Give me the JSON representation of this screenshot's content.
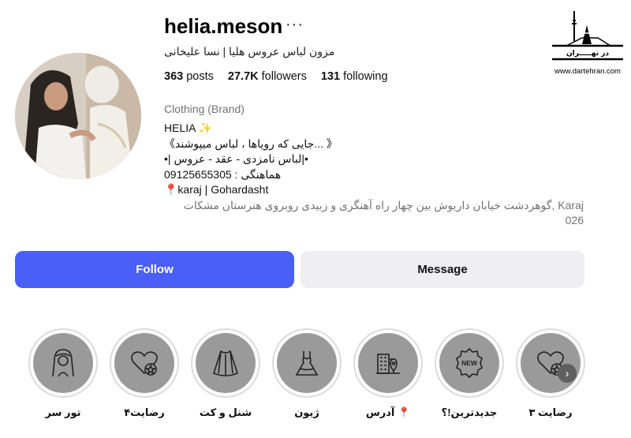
{
  "profile": {
    "username": "helia.meson",
    "more_glyph": "···",
    "full_name": "مزون لباس عروس هلیا | نسا علیخانی",
    "stats": {
      "posts_count": "363",
      "posts_label": "posts",
      "followers_count": "27.7K",
      "followers_label": "followers",
      "following_count": "131",
      "following_label": "following"
    },
    "category": "Clothing (Brand)",
    "bio": "HELIA ✨\n《جایی که رویاها ، لباس میپوشند... 》\n•| لباس نامزدی - عقد - عروس|•\nهماهنگی : 09125655305\n📍karaj | Gohardasht",
    "address": "گوهردشت خیابان داریوش بین چهار راه آهنگری و زبیدی روبروی هنرستان مشکات, Karaj\n026"
  },
  "actions": {
    "follow_label": "Follow",
    "message_label": "Message"
  },
  "highlights": [
    {
      "label": "تور سر",
      "icon": "bride-veil-icon"
    },
    {
      "label": "رضایت۴",
      "icon": "heart-star-icon"
    },
    {
      "label": "شنل و کت",
      "icon": "cape-icon"
    },
    {
      "label": "ژیون",
      "icon": "wedding-dress-icon"
    },
    {
      "label": "آدرس 📍",
      "icon": "building-pin-icon"
    },
    {
      "label": "جدیدترین!؟",
      "icon": "new-badge-icon"
    },
    {
      "label": "رضایت ۳",
      "icon": "heart-star-icon"
    }
  ],
  "watermark": {
    "logo_text": "در تهـــــران",
    "url": "www.dartehran.com"
  },
  "colors": {
    "follow_button": "#4a5ef8",
    "message_button": "#efeff1",
    "secondary_text": "#737373"
  }
}
